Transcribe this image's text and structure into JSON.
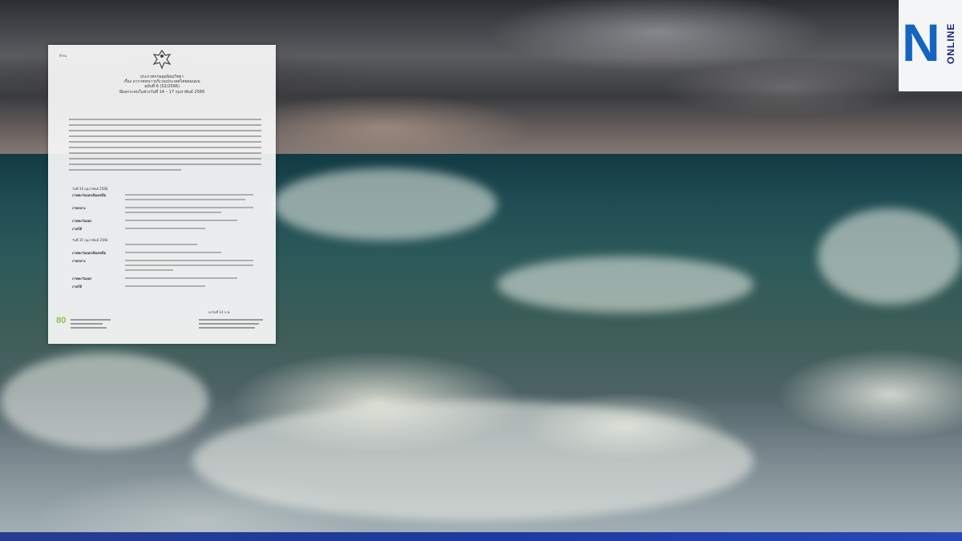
{
  "brand": {
    "logo_letter": "N",
    "logo_word": "ONLINE",
    "colors": {
      "logo_blue": "#1565c0",
      "bar_blue": "#1f3a9e"
    }
  },
  "document": {
    "reference": "ที่ ทบ.",
    "title_line1": "ประกาศกรมอุตุนิยมวิทยา",
    "title_line2": "เรื่อง อากาศหนาวบริเวณประเทศไทยตอนบน",
    "title_line3": "ฉบับที่ 6 (52/2566)",
    "title_line4": "มีผลกระทบในช่วงวันที่ 14 – 17 กุมภาพันธ์ 2566",
    "date1": "วันที่ 14 กุมภาพันธ์ 2566",
    "date2": "วันที่ 15 กุมภาพันธ์ 2566",
    "region1": "ภาคตะวันออกเฉียงเหนือ",
    "region2": "ภาคกลาง",
    "region3": "ภาคตะวันออก",
    "region4": "ภาคใต้",
    "signature": "ลงวันที่ 14 ก.พ.",
    "logo_number": "80"
  }
}
